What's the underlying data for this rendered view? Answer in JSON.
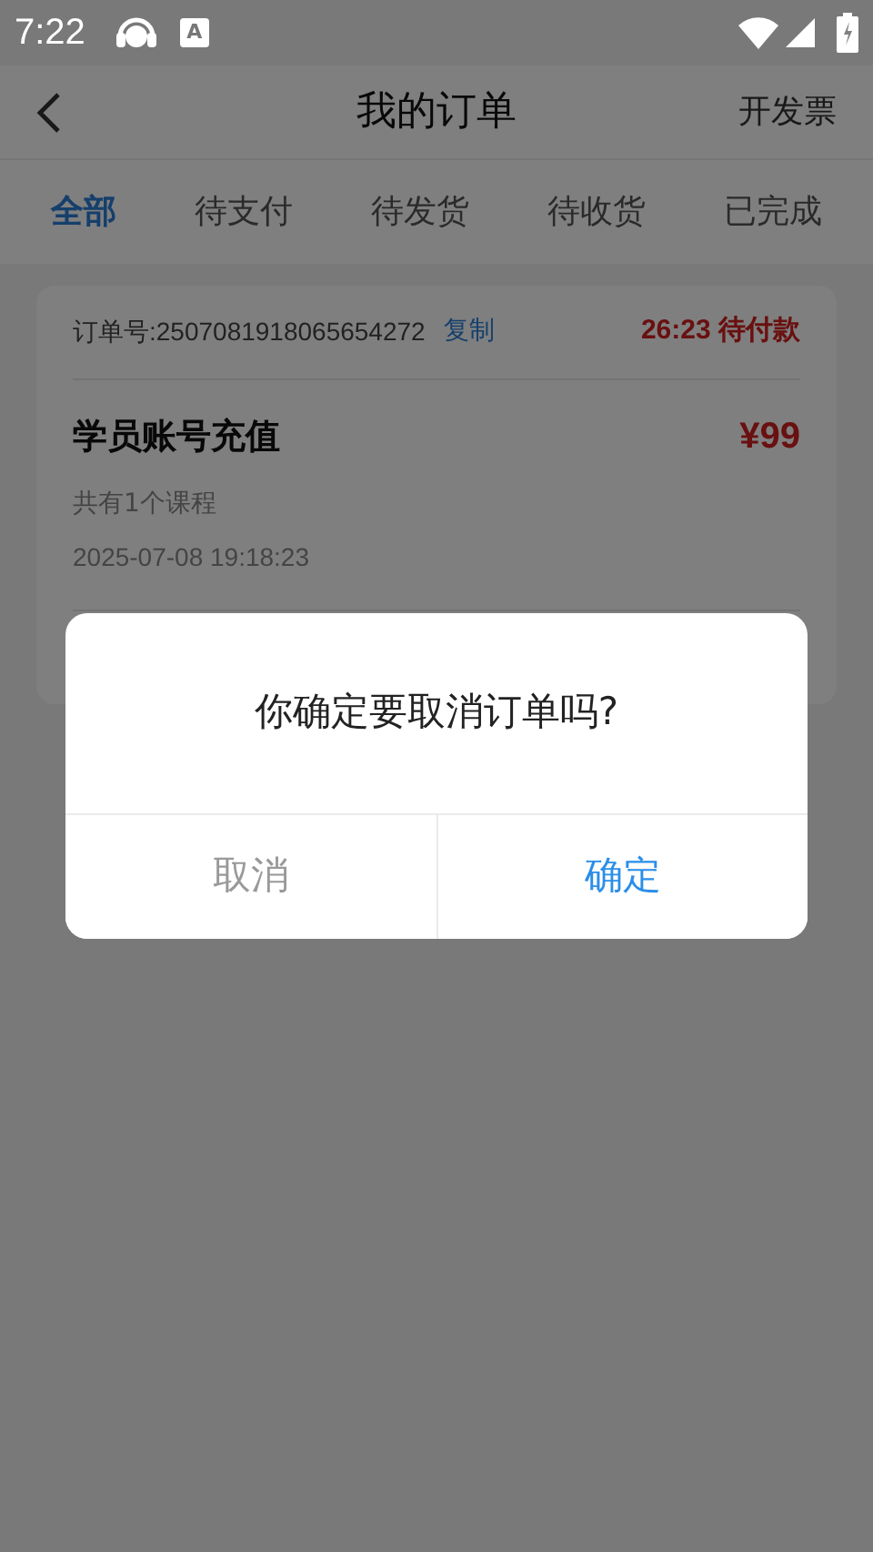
{
  "status_bar": {
    "time": "7:22",
    "notification_letter": "A"
  },
  "header": {
    "title": "我的订单",
    "action": "开发票"
  },
  "tabs": [
    {
      "label": "全部",
      "selected": true
    },
    {
      "label": "待支付",
      "selected": false
    },
    {
      "label": "待发货",
      "selected": false
    },
    {
      "label": "待收货",
      "selected": false
    },
    {
      "label": "已完成",
      "selected": false
    }
  ],
  "orders": [
    {
      "order_number": "订单号:2507081918065654272",
      "copy_link": "复制",
      "status": "26:23 待付款",
      "title": "学员账号充值",
      "price": "¥99",
      "course_count": "共有1个课程",
      "date": "2025-07-08 19:18:23"
    }
  ],
  "dialog": {
    "message": "你确定要取消订单吗?",
    "buttons": [
      {
        "label": "取消",
        "kind": "cancel"
      },
      {
        "label": "确定",
        "kind": "confirm"
      }
    ]
  }
}
